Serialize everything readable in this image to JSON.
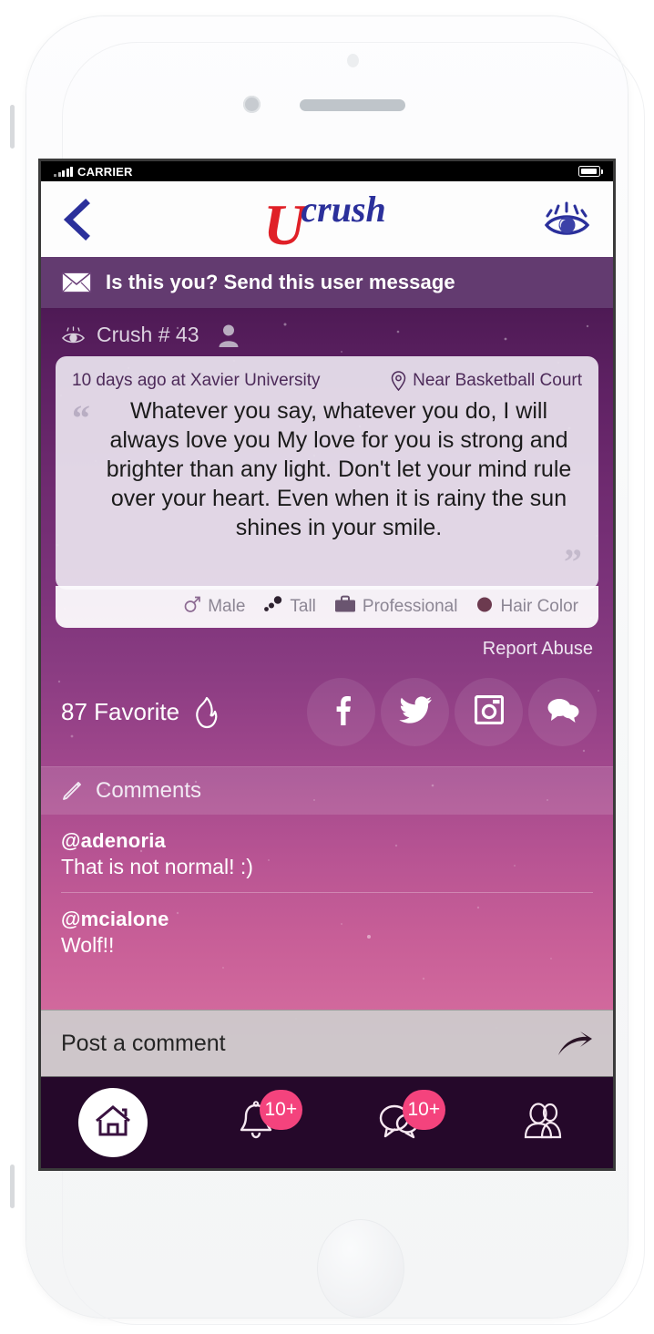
{
  "status_bar": {
    "carrier": "CARRIER",
    "signal_icon": "signal-bars-icon",
    "battery_icon": "battery-icon"
  },
  "nav_bar": {
    "back_icon": "back-chevron-icon",
    "logo_primary": "U",
    "logo_secondary": "crush",
    "eye_icon": "eye-icon"
  },
  "message_banner": {
    "icon": "envelope-icon",
    "label": "Is this you? Send this user message"
  },
  "crush_meta": {
    "eye_icon": "eye-icon",
    "label": "Crush # 43",
    "avatar_icon": "anonymous-avatar-icon"
  },
  "quote_card": {
    "date_location": "10 days ago at Xavier University",
    "pin_icon": "map-pin-icon",
    "place": "Near Basketball Court",
    "open_quote": "“",
    "close_quote": "”",
    "text": "Whatever you say, whatever you do, I will always love you My love for you is strong and brighter than any light. Don't let your mind rule over your heart. Even when it is rainy the sun shines in your smile."
  },
  "attributes": [
    {
      "icon": "gender-male-icon",
      "label": "Male"
    },
    {
      "icon": "height-tall-icon",
      "label": "Tall"
    },
    {
      "icon": "briefcase-icon",
      "label": "Professional"
    },
    {
      "icon": "hair-color-dot-icon",
      "label": "Hair Color"
    }
  ],
  "report_abuse": {
    "label": "Report Abuse"
  },
  "social_row": {
    "favorite_label": "87 Favorite",
    "flame_icon": "flame-icon",
    "buttons": [
      {
        "icon": "facebook-icon",
        "name": "facebook"
      },
      {
        "icon": "twitter-icon",
        "name": "twitter"
      },
      {
        "icon": "instagram-icon",
        "name": "instagram"
      },
      {
        "icon": "comment-bubbles-icon",
        "name": "comment"
      }
    ]
  },
  "comments_section": {
    "icon": "pencil-icon",
    "header": "Comments",
    "items": [
      {
        "author": "@adenoria",
        "text": "That is not normal! :)"
      },
      {
        "author": "@mcialone",
        "text": "Wolf!!"
      }
    ]
  },
  "post_comment": {
    "placeholder": "Post a comment",
    "value": "",
    "send_icon": "send-arrow-icon"
  },
  "tab_bar": [
    {
      "name": "home",
      "icon": "home-icon",
      "badge": ""
    },
    {
      "name": "notifications",
      "icon": "bell-icon",
      "badge": "10+"
    },
    {
      "name": "messages",
      "icon": "chat-bubbles-icon",
      "badge": "10+"
    },
    {
      "name": "friends",
      "icon": "people-icon",
      "badge": ""
    }
  ],
  "colors": {
    "logo_red": "#e02027",
    "logo_blue": "#2b309b",
    "badge_pink": "#f4437d",
    "tab_bar_dark": "#25082a",
    "banner_purple": "#704680"
  }
}
